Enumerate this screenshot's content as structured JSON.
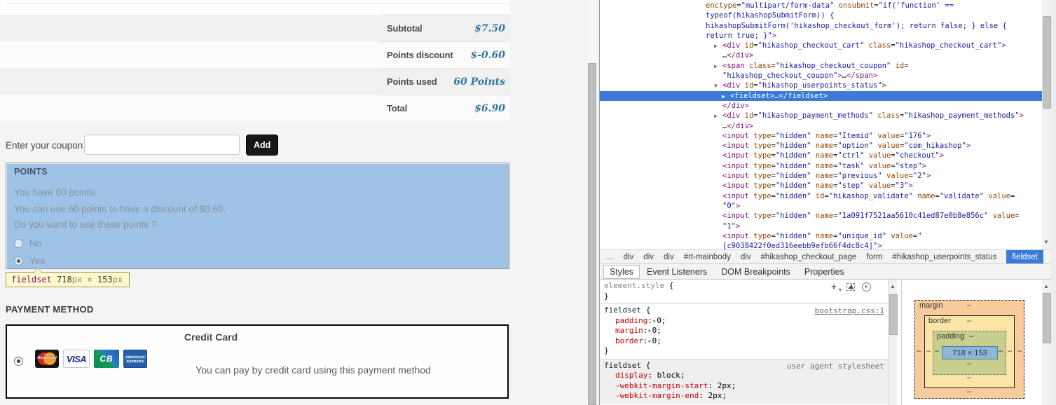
{
  "colors": {
    "inspect_highlight": "#9fc3e7",
    "devtools_selection": "#3b7bd7",
    "price_text": "#33759f"
  },
  "page": {
    "totals": {
      "rows": [
        {
          "label": "Subtotal",
          "value": "$7.50"
        },
        {
          "label": "Points discount",
          "value": "$-0.60"
        },
        {
          "label": "Points used",
          "value": "60 Points"
        },
        {
          "label": "Total",
          "value": "$6.90"
        }
      ]
    },
    "coupon": {
      "label": "Enter your coupon",
      "input_value": "",
      "button_label": "Add"
    },
    "points": {
      "legend": "POINTS",
      "lines": [
        "You have 60 points.",
        "You can use 60 points to have a discount of $0.60.",
        "Do you want to use these points ?"
      ],
      "options": [
        {
          "label": "No",
          "selected": false
        },
        {
          "label": "Yes",
          "selected": true
        }
      ]
    },
    "inspect_tooltip": {
      "tag": "fieldset",
      "width": "718",
      "height": "153",
      "unit": "px",
      "sep": "×"
    },
    "payment": {
      "heading": "PAYMENT METHOD",
      "method_title": "Credit Card",
      "description": "You can pay by credit card using this payment method",
      "cards": [
        {
          "name": "MasterCard",
          "label": "MasterCard"
        },
        {
          "name": "Visa",
          "label": "VISA"
        },
        {
          "name": "CB",
          "label": "CB"
        },
        {
          "name": "American Express",
          "label_line1": "AMERICAN",
          "label_line2": "EXPRESS"
        }
      ]
    }
  },
  "devtools": {
    "tree": {
      "lines": [
        {
          "lv": "c",
          "p": [
            [
              "a",
              "enctype"
            ],
            [
              "p",
              "="
            ],
            [
              "v",
              "\"multipart/form-data\""
            ],
            [
              "p",
              " "
            ],
            [
              "a",
              "onsubmit"
            ],
            [
              "p",
              "="
            ],
            [
              "v",
              "\"if('function' =="
            ]
          ]
        },
        {
          "lv": "c",
          "p": [
            [
              "v",
              "typeof(hikashopSubmitForm)) {"
            ]
          ]
        },
        {
          "lv": "c",
          "p": [
            [
              "v",
              "hikashopSubmitForm('hikashop_checkout_form'); return false; } else {"
            ]
          ]
        },
        {
          "lv": "c",
          "p": [
            [
              "v",
              "return true; }\""
            ],
            [
              "t",
              ">"
            ]
          ]
        },
        {
          "lv": "el",
          "ar": "r",
          "p": [
            [
              "t",
              "<div"
            ],
            [
              "p",
              " "
            ],
            [
              "a",
              "id"
            ],
            [
              "p",
              "="
            ],
            [
              "v",
              "\"hikashop_checkout_cart\""
            ],
            [
              "p",
              " "
            ],
            [
              "a",
              "class"
            ],
            [
              "p",
              "="
            ],
            [
              "v",
              "\"hikashop_checkout_cart\""
            ],
            [
              "t",
              ">"
            ]
          ]
        },
        {
          "lv": "tx",
          "p": [
            [
              "e",
              "…"
            ],
            [
              "t",
              "</div>"
            ]
          ]
        },
        {
          "lv": "el",
          "ar": "r",
          "p": [
            [
              "t",
              "<span"
            ],
            [
              "p",
              " "
            ],
            [
              "a",
              "class"
            ],
            [
              "p",
              "="
            ],
            [
              "v",
              "\"hikashop_checkout_coupon\""
            ],
            [
              "p",
              " "
            ],
            [
              "a",
              "id"
            ],
            [
              "p",
              "="
            ]
          ]
        },
        {
          "lv": "tx",
          "p": [
            [
              "v",
              "\"hikashop_checkout_coupon\""
            ],
            [
              "t",
              ">"
            ],
            [
              "e",
              "…"
            ],
            [
              "t",
              "</span>"
            ]
          ]
        },
        {
          "lv": "el",
          "ar": "d",
          "p": [
            [
              "t",
              "<div"
            ],
            [
              "p",
              " "
            ],
            [
              "a",
              "id"
            ],
            [
              "p",
              "="
            ],
            [
              "v",
              "\"hikashop_userpoints_status\""
            ],
            [
              "t",
              ">"
            ]
          ]
        },
        {
          "lv": "sub",
          "ar": "r",
          "hl": true,
          "p": [
            [
              "t",
              "<fieldset>"
            ],
            [
              "e",
              "…"
            ],
            [
              "t",
              "</fieldset>"
            ]
          ]
        },
        {
          "lv": "tx",
          "p": [
            [
              "t",
              "</div>"
            ]
          ]
        },
        {
          "lv": "el",
          "ar": "r",
          "p": [
            [
              "t",
              "<div"
            ],
            [
              "p",
              " "
            ],
            [
              "a",
              "id"
            ],
            [
              "p",
              "="
            ],
            [
              "v",
              "\"hikashop_payment_methods\""
            ],
            [
              "p",
              " "
            ],
            [
              "a",
              "class"
            ],
            [
              "p",
              "="
            ],
            [
              "v",
              "\"hikashop_payment_methods\""
            ],
            [
              "t",
              ">"
            ]
          ]
        },
        {
          "lv": "tx",
          "p": [
            [
              "e",
              "…"
            ],
            [
              "t",
              "</div>"
            ]
          ]
        },
        {
          "lv": "tx",
          "p": [
            [
              "t",
              "<input"
            ],
            [
              "p",
              " "
            ],
            [
              "a",
              "type"
            ],
            [
              "p",
              "="
            ],
            [
              "v",
              "\"hidden\""
            ],
            [
              "p",
              " "
            ],
            [
              "a",
              "name"
            ],
            [
              "p",
              "="
            ],
            [
              "v",
              "\"Itemid\""
            ],
            [
              "p",
              " "
            ],
            [
              "a",
              "value"
            ],
            [
              "p",
              "="
            ],
            [
              "v",
              "\"176\""
            ],
            [
              "t",
              ">"
            ]
          ]
        },
        {
          "lv": "tx",
          "p": [
            [
              "t",
              "<input"
            ],
            [
              "p",
              " "
            ],
            [
              "a",
              "type"
            ],
            [
              "p",
              "="
            ],
            [
              "v",
              "\"hidden\""
            ],
            [
              "p",
              " "
            ],
            [
              "a",
              "name"
            ],
            [
              "p",
              "="
            ],
            [
              "v",
              "\"option\""
            ],
            [
              "p",
              " "
            ],
            [
              "a",
              "value"
            ],
            [
              "p",
              "="
            ],
            [
              "v",
              "\"com_hikashop\""
            ],
            [
              "t",
              ">"
            ]
          ]
        },
        {
          "lv": "tx",
          "p": [
            [
              "t",
              "<input"
            ],
            [
              "p",
              " "
            ],
            [
              "a",
              "type"
            ],
            [
              "p",
              "="
            ],
            [
              "v",
              "\"hidden\""
            ],
            [
              "p",
              " "
            ],
            [
              "a",
              "name"
            ],
            [
              "p",
              "="
            ],
            [
              "v",
              "\"ctrl\""
            ],
            [
              "p",
              " "
            ],
            [
              "a",
              "value"
            ],
            [
              "p",
              "="
            ],
            [
              "v",
              "\"checkout\""
            ],
            [
              "t",
              ">"
            ]
          ]
        },
        {
          "lv": "tx",
          "p": [
            [
              "t",
              "<input"
            ],
            [
              "p",
              " "
            ],
            [
              "a",
              "type"
            ],
            [
              "p",
              "="
            ],
            [
              "v",
              "\"hidden\""
            ],
            [
              "p",
              " "
            ],
            [
              "a",
              "name"
            ],
            [
              "p",
              "="
            ],
            [
              "v",
              "\"task\""
            ],
            [
              "p",
              " "
            ],
            [
              "a",
              "value"
            ],
            [
              "p",
              "="
            ],
            [
              "v",
              "\"step\""
            ],
            [
              "t",
              ">"
            ]
          ]
        },
        {
          "lv": "tx",
          "p": [
            [
              "t",
              "<input"
            ],
            [
              "p",
              " "
            ],
            [
              "a",
              "type"
            ],
            [
              "p",
              "="
            ],
            [
              "v",
              "\"hidden\""
            ],
            [
              "p",
              " "
            ],
            [
              "a",
              "name"
            ],
            [
              "p",
              "="
            ],
            [
              "v",
              "\"previous\""
            ],
            [
              "p",
              " "
            ],
            [
              "a",
              "value"
            ],
            [
              "p",
              "="
            ],
            [
              "v",
              "\"2\""
            ],
            [
              "t",
              ">"
            ]
          ]
        },
        {
          "lv": "tx",
          "p": [
            [
              "t",
              "<input"
            ],
            [
              "p",
              " "
            ],
            [
              "a",
              "type"
            ],
            [
              "p",
              "="
            ],
            [
              "v",
              "\"hidden\""
            ],
            [
              "p",
              " "
            ],
            [
              "a",
              "name"
            ],
            [
              "p",
              "="
            ],
            [
              "v",
              "\"step\""
            ],
            [
              "p",
              " "
            ],
            [
              "a",
              "value"
            ],
            [
              "p",
              "="
            ],
            [
              "v",
              "\"3\""
            ],
            [
              "t",
              ">"
            ]
          ]
        },
        {
          "lv": "tx",
          "p": [
            [
              "t",
              "<input"
            ],
            [
              "p",
              " "
            ],
            [
              "a",
              "type"
            ],
            [
              "p",
              "="
            ],
            [
              "v",
              "\"hidden\""
            ],
            [
              "p",
              " "
            ],
            [
              "a",
              "id"
            ],
            [
              "p",
              "="
            ],
            [
              "v",
              "\"hikashop_validate\""
            ],
            [
              "p",
              " "
            ],
            [
              "a",
              "name"
            ],
            [
              "p",
              "="
            ],
            [
              "v",
              "\"validate\""
            ],
            [
              "p",
              " "
            ],
            [
              "a",
              "value"
            ],
            [
              "p",
              "="
            ]
          ]
        },
        {
          "lv": "tx",
          "p": [
            [
              "v",
              "\"0\""
            ],
            [
              "t",
              ">"
            ]
          ]
        },
        {
          "lv": "tx",
          "p": [
            [
              "t",
              "<input"
            ],
            [
              "p",
              " "
            ],
            [
              "a",
              "type"
            ],
            [
              "p",
              "="
            ],
            [
              "v",
              "\"hidden\""
            ],
            [
              "p",
              " "
            ],
            [
              "a",
              "name"
            ],
            [
              "p",
              "="
            ],
            [
              "v",
              "\"1a091f7521aa5610c41ed87e0b8e856c\""
            ],
            [
              "p",
              " "
            ],
            [
              "a",
              "value"
            ],
            [
              "p",
              "="
            ]
          ]
        },
        {
          "lv": "tx",
          "p": [
            [
              "v",
              "\"1\""
            ],
            [
              "t",
              ">"
            ]
          ]
        },
        {
          "lv": "tx",
          "p": [
            [
              "t",
              "<input"
            ],
            [
              "p",
              " "
            ],
            [
              "a",
              "type"
            ],
            [
              "p",
              "="
            ],
            [
              "v",
              "\"hidden\""
            ],
            [
              "p",
              " "
            ],
            [
              "a",
              "name"
            ],
            [
              "p",
              "="
            ],
            [
              "v",
              "\"unique_id\""
            ],
            [
              "p",
              " "
            ],
            [
              "a",
              "value"
            ],
            [
              "p",
              "="
            ],
            [
              "v",
              "\""
            ]
          ]
        },
        {
          "lv": "tx",
          "p": [
            [
              "v",
              "[c9038422f0ed316eebb9efb66f4dc8c4]\""
            ],
            [
              "t",
              ">"
            ]
          ]
        }
      ]
    },
    "crumbs": [
      {
        "label": "...",
        "selected": false
      },
      {
        "label": "div",
        "selected": false
      },
      {
        "label": "div",
        "selected": false
      },
      {
        "label": "div",
        "selected": false
      },
      {
        "label": "#rt-mainbody",
        "selected": false
      },
      {
        "label": "div",
        "selected": false
      },
      {
        "label": "#hikashop_checkout_page",
        "selected": false
      },
      {
        "label": "form",
        "selected": false
      },
      {
        "label": "#hikashop_userpoints_status",
        "selected": false
      },
      {
        "label": "fieldset",
        "selected": true
      }
    ],
    "tabs": [
      {
        "label": "Styles",
        "active": true
      },
      {
        "label": "Event Listeners",
        "active": false
      },
      {
        "label": "DOM Breakpoints",
        "active": false
      },
      {
        "label": "Properties",
        "active": false
      }
    ],
    "styles": {
      "rules": [
        {
          "selector": "element.style",
          "gray_selector": true,
          "link": "",
          "link_is_url": false,
          "icons": true,
          "close": true,
          "readonly": false,
          "props": []
        },
        {
          "selector": "fieldset",
          "gray_selector": false,
          "link": "bootstrap.css:1",
          "link_is_url": true,
          "icons": false,
          "close": true,
          "readonly": false,
          "props": [
            {
              "name": "padding",
              "value": "0",
              "expand": true
            },
            {
              "name": "margin",
              "value": "0",
              "expand": true
            },
            {
              "name": "border",
              "value": "0",
              "expand": true
            }
          ]
        },
        {
          "selector": "fieldset",
          "gray_selector": false,
          "link": "user agent stylesheet",
          "link_is_url": false,
          "icons": false,
          "close": false,
          "readonly": true,
          "props": [
            {
              "name": "display",
              "value": " block",
              "expand": false
            },
            {
              "name": "-webkit-margin-start",
              "value": " 2px",
              "expand": false
            },
            {
              "name": "-webkit-margin-end",
              "value": " 2px",
              "expand": false
            }
          ]
        }
      ]
    },
    "box_model": {
      "margin_label": "margin",
      "border_label": "border",
      "padding_label": "padding",
      "content": "718 × 153",
      "dash": "–"
    }
  }
}
